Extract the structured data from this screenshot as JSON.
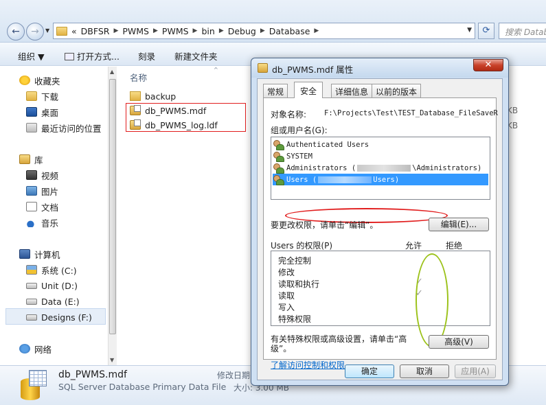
{
  "explorer": {
    "breadcrumb": [
      "«",
      "DBFSR",
      "PWMS",
      "PWMS",
      "bin",
      "Debug",
      "Database"
    ],
    "search_placeholder": "搜索 Database",
    "toolbar": {
      "organize": "组织 ▼",
      "open_with": "打开方式...",
      "burn": "刻录",
      "new_folder": "新建文件夹"
    },
    "nav": {
      "favorites": "收藏夹",
      "downloads": "下载",
      "desktop": "桌面",
      "recent": "最近访问的位置",
      "libraries": "库",
      "videos": "视频",
      "pictures": "图片",
      "documents": "文档",
      "music": "音乐",
      "computer": "计算机",
      "drive_c": "系统 (C:)",
      "drive_d": "Unit (D:)",
      "drive_e": "Data (E:)",
      "drive_f": "Designs (F:)",
      "network": "网络"
    },
    "file_list": {
      "column_name": "名称",
      "files": [
        "backup",
        "db_PWMS.mdf",
        "db_PWMS_log.ldf"
      ],
      "size_suffix": [
        "KB",
        "KB"
      ]
    },
    "details": {
      "name": "db_PWMS.mdf",
      "type": "SQL Server Database Primary Data File",
      "modified_label": "修改日期",
      "size_label": "大小: 3.00 MB"
    }
  },
  "dialog": {
    "title": "db_PWMS.mdf 属性",
    "close": "✕",
    "tabs": [
      "常规",
      "安全",
      "详细信息",
      "以前的版本"
    ],
    "object_label": "对象名称:",
    "object_value": "F:\\Projects\\Test\\TEST_Database_FileSaveR",
    "group_label": "组或用户名(G):",
    "users": [
      {
        "name": "Authenticated Users"
      },
      {
        "name": "SYSTEM"
      },
      {
        "name_pre": "Administrators (",
        "name_post": "\\Administrators)"
      },
      {
        "name_pre": "Users (",
        "name_post": "Users)"
      }
    ],
    "change_label": "要更改权限，请单击“编辑”。",
    "edit_button": "编辑(E)...",
    "perm_label": "Users 的权限(P)",
    "allow": "允许",
    "deny": "拒绝",
    "permissions": [
      "完全控制",
      "修改",
      "读取和执行",
      "读取",
      "写入",
      "特殊权限"
    ],
    "checkmark": "✓",
    "special_label_1": "有关特殊权限或高级设置，请单击“高",
    "special_label_2": "级”。",
    "advanced_button": "高级(V)",
    "learn_link": "了解访问控制和权限",
    "ok": "确定",
    "cancel": "取消",
    "apply": "应用(A)"
  }
}
